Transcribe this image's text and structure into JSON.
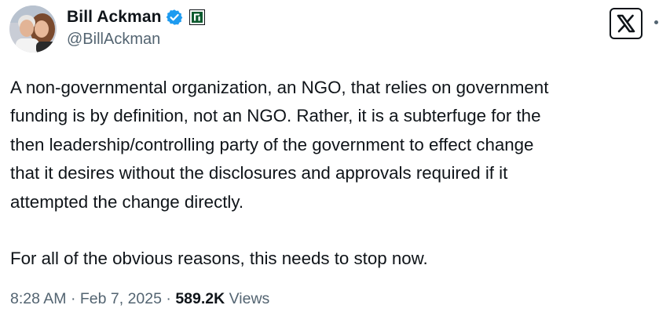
{
  "author": {
    "display_name": "Bill Ackman",
    "handle": "@BillAckman",
    "avatar_icon": "profile-photo",
    "verified_icon": "verified-badge-icon",
    "verified_color": "#1d9bf0",
    "affiliation_icon": "affiliation-badge-icon",
    "affiliation_color": "#0b5a2e"
  },
  "post": {
    "text": "A non-governmental organization, an NGO, that relies on government\nfunding is by definition, not an NGO. Rather, it is a subterfuge for the\nthen leadership/controlling party of the government to effect change\nthat it desires without the disclosures and approvals required if it\nattempted the change directly.\n\nFor all of the obvious reasons, this needs to stop now."
  },
  "meta": {
    "time": "8:28 AM",
    "separator": " · ",
    "date": "Feb 7, 2025",
    "views_count": "589.2K",
    "views_label": " Views"
  },
  "platform": {
    "logo_icon": "x-logo-icon"
  },
  "colors": {
    "text_primary": "#0f1419",
    "text_secondary": "#536471",
    "background": "#ffffff"
  }
}
